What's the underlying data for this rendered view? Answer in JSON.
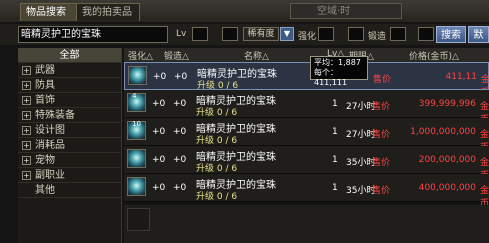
{
  "tabs": {
    "search": "物品搜索",
    "my_listings": "我的拍卖品"
  },
  "status_box": "空域·时",
  "filter": {
    "search_value": "暗精灵护卫的宝珠",
    "lv_label": "Lv",
    "rarity_label": "稀有度",
    "enhance_label": "强化",
    "forge_label": "锻造",
    "search_button": "搜索",
    "extra_button": "默"
  },
  "sidebar": {
    "items": [
      {
        "label": "全部",
        "expandable": false
      },
      {
        "label": "武器",
        "expandable": true
      },
      {
        "label": "防具",
        "expandable": true
      },
      {
        "label": "首饰",
        "expandable": true
      },
      {
        "label": "特殊装备",
        "expandable": true
      },
      {
        "label": "设计图",
        "expandable": true
      },
      {
        "label": "消耗品",
        "expandable": true
      },
      {
        "label": "宠物",
        "expandable": true
      },
      {
        "label": "副职业",
        "expandable": true
      },
      {
        "label": "其他",
        "expandable": false
      }
    ]
  },
  "columns": {
    "enhance": "强化△",
    "forge": "锻造△",
    "name": "名称△",
    "level": "Lv△",
    "time": "期限△",
    "price": "价格(金币)△"
  },
  "tooltip": {
    "avg": "平均：1,887",
    "each": "每个：411,111"
  },
  "listings": [
    {
      "qty": "",
      "enhance": "+0",
      "forge": "+0",
      "name": "暗精灵护卫的宝珠",
      "upgrade": "升级 0 / 6",
      "count": "",
      "time": "",
      "sale": "售价",
      "price": "411,11",
      "currency": "金币"
    },
    {
      "qty": "4",
      "enhance": "+0",
      "forge": "+0",
      "name": "暗精灵护卫的宝珠",
      "upgrade": "升级 0 / 6",
      "count": "1",
      "time": "27小时",
      "sale": "售价",
      "price": "399,999,996",
      "currency": "金币"
    },
    {
      "qty": "10",
      "enhance": "+0",
      "forge": "+0",
      "name": "暗精灵护卫的宝珠",
      "upgrade": "升级 0 / 6",
      "count": "1",
      "time": "27小时",
      "sale": "售价",
      "price": "1,000,000,000",
      "currency": "金币"
    },
    {
      "qty": "",
      "enhance": "+0",
      "forge": "+0",
      "name": "暗精灵护卫的宝珠",
      "upgrade": "升级 0 / 6",
      "count": "1",
      "time": "35小时",
      "sale": "售价",
      "price": "200,000,000",
      "currency": "金币"
    },
    {
      "qty": "",
      "enhance": "+0",
      "forge": "+0",
      "name": "暗精灵护卫的宝珠",
      "upgrade": "升级 0 / 6",
      "count": "1",
      "time": "35小时",
      "sale": "售价",
      "price": "400,000,000",
      "currency": "金币"
    }
  ]
}
